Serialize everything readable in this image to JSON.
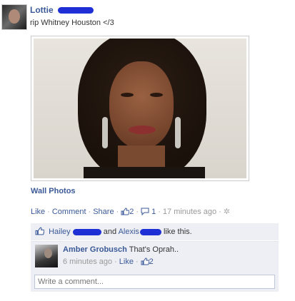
{
  "post": {
    "author": "Lottie",
    "status_text": "rip Whitney Houston </3",
    "photo_caption": "Wall Photos",
    "actions": {
      "like": "Like",
      "comment": "Comment",
      "share": "Share",
      "likes_count": "2",
      "comments_count": "1",
      "time": "17 minutes ago"
    }
  },
  "likes_bar": {
    "name1": "Hailey",
    "conj": "and",
    "name2": "Alexis",
    "suffix": "like this."
  },
  "comment": {
    "author": "Amber Grobusch",
    "text": "That's Oprah..",
    "time": "6 minutes ago",
    "like": "Like",
    "likes_count": "2"
  },
  "comment_input": {
    "placeholder": "Write a comment..."
  },
  "colors": {
    "link": "#3b5998",
    "panel": "#edeff4",
    "scribble": "#1f2fd6"
  }
}
